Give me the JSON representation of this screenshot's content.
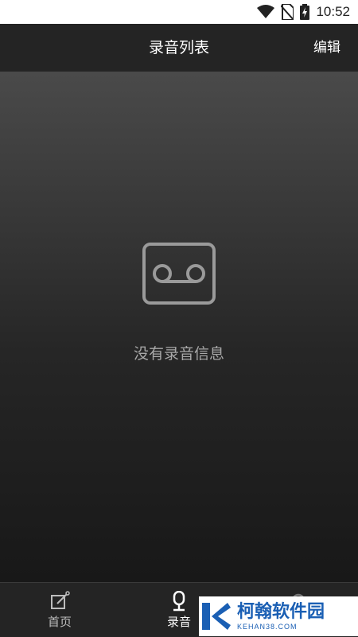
{
  "status_bar": {
    "time": "10:52",
    "icons": [
      "wifi-icon",
      "no-sim-icon",
      "battery-charging-icon"
    ]
  },
  "header": {
    "title": "录音列表",
    "edit_label": "编辑"
  },
  "main": {
    "empty_icon": "cassette-tape-icon",
    "empty_message": "没有录音信息"
  },
  "tabbar": {
    "items": [
      {
        "label": "首页",
        "icon": "edit-note-icon",
        "active": false
      },
      {
        "label": "录音",
        "icon": "microphone-icon",
        "active": true
      }
    ]
  },
  "watermark": {
    "title": "柯翰软件园",
    "subtitle": "KEHAN38.COM"
  },
  "colors": {
    "header_bg": "#242424",
    "status_bar_bg": "#ffffff",
    "empty_text": "#a8a8a8",
    "watermark_blue": "#1a5fb4"
  }
}
